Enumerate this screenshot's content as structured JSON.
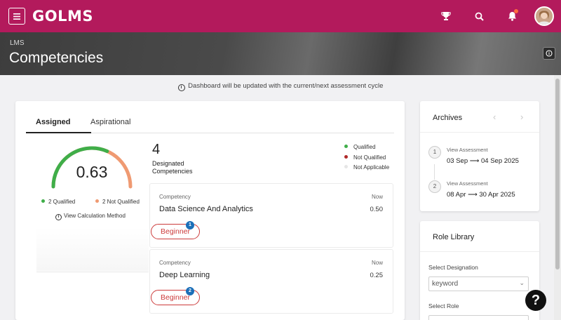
{
  "app": {
    "logo": "GOLMS"
  },
  "header": {
    "breadcrumb": "LMS",
    "title": "Competencies"
  },
  "notice": "Dashboard will be updated with the current/next assessment cycle",
  "tabs": [
    {
      "label": "Assigned",
      "active": true
    },
    {
      "label": "Aspirational",
      "active": false
    }
  ],
  "gauge": {
    "value": "0.63",
    "fraction": 0.63,
    "qualified_label": "2 Qualified",
    "not_qualified_label": "2 Not Qualified",
    "calc_link": "View Calculation Method",
    "colors": {
      "qualified": "#3fae49",
      "not_qualified": "#ef9a72"
    }
  },
  "summary": {
    "count": "4",
    "label_line1": "Designated",
    "label_line2": "Competencies"
  },
  "status_legend": [
    {
      "label": "Qualified",
      "color": "#3fae49"
    },
    {
      "label": "Not Qualified",
      "color": "#b02a2a"
    },
    {
      "label": "Not Applicable",
      "color": "#e6e6e6"
    }
  ],
  "competencies": [
    {
      "kicker": "Competency",
      "name": "Data Science And Analytics",
      "now_label": "Now",
      "score": "0.50",
      "level": "Beginner",
      "badge": "1"
    },
    {
      "kicker": "Competency",
      "name": "Deep Learning",
      "now_label": "Now",
      "score": "0.25",
      "level": "Beginner",
      "badge": "2"
    }
  ],
  "archives": {
    "title": "Archives",
    "items": [
      {
        "step": "1",
        "label": "View Assessment",
        "range": "03 Sep ⟶ 04 Sep 2025"
      },
      {
        "step": "2",
        "label": "View Assessment",
        "range": "08 Apr ⟶ 30 Apr 2025"
      }
    ]
  },
  "role_library": {
    "title": "Role Library",
    "designation_label": "Select Designation",
    "designation_placeholder": "keyword",
    "role_label": "Select Role"
  },
  "help": "?",
  "icons": [
    "menu-icon",
    "trophy-icon",
    "search-icon",
    "bell-icon",
    "info-icon",
    "chevron-left-icon",
    "chevron-right-icon",
    "chevron-down-icon",
    "help-icon"
  ]
}
